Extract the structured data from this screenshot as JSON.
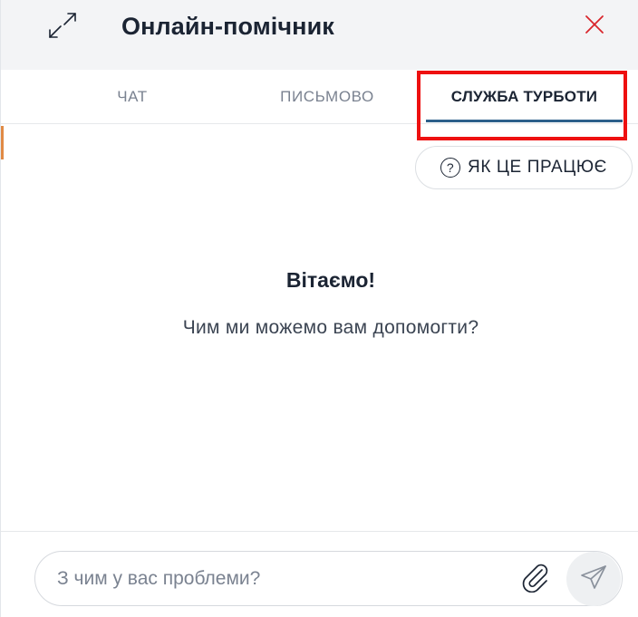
{
  "header": {
    "title": "Онлайн-помічник",
    "expand_icon": "expand-icon",
    "close_icon": "close-icon",
    "close_color": "#d9262c",
    "background": "#f3f4f6"
  },
  "tabs": [
    {
      "label": "ЧАТ",
      "active": false
    },
    {
      "label": "ПИСЬМОВО",
      "active": false
    },
    {
      "label": "СЛУЖБА ТУРБОТИ",
      "active": true
    }
  ],
  "accent": {
    "tab_underline": "#2c5f8a",
    "highlight_border": "#ee1010",
    "left_edge": "#e08a45"
  },
  "help_button": {
    "label": "ЯК ЦЕ ПРАЦЮЄ",
    "icon": "question-circle-icon"
  },
  "main": {
    "greeting": "Вітаємо!",
    "subtext": "Чим ми можемо вам допомогти?"
  },
  "composer": {
    "placeholder": "З чим у вас проблеми?",
    "value": "",
    "attach_icon": "paperclip-icon",
    "send_icon": "send-icon"
  }
}
